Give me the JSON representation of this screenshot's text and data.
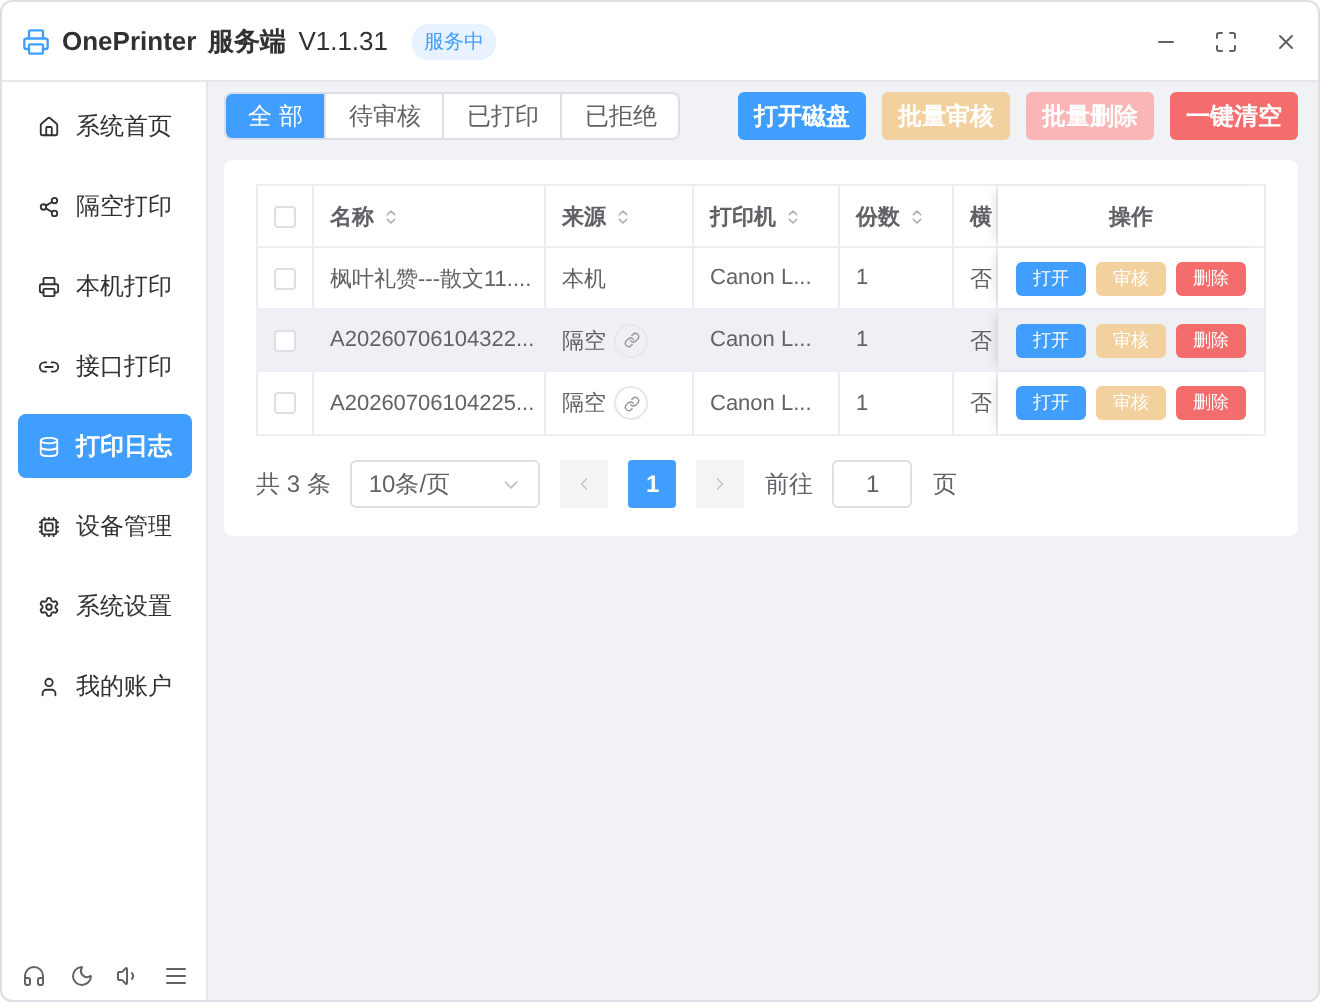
{
  "window": {
    "app": "OnePrinter",
    "subtitle": "服务端",
    "version": "V1.1.31",
    "status": "服务中"
  },
  "sidebar": {
    "items": [
      {
        "label": "系统首页",
        "selected": false
      },
      {
        "label": "隔空打印",
        "selected": false
      },
      {
        "label": "本机打印",
        "selected": false
      },
      {
        "label": "接口打印",
        "selected": false
      },
      {
        "label": "打印日志",
        "selected": true
      },
      {
        "label": "设备管理",
        "selected": false
      },
      {
        "label": "系统设置",
        "selected": false
      },
      {
        "label": "我的账户",
        "selected": false
      }
    ]
  },
  "tabs": [
    {
      "label": "全 部",
      "selected": true
    },
    {
      "label": "待审核",
      "selected": false
    },
    {
      "label": "已打印",
      "selected": false
    },
    {
      "label": "已拒绝",
      "selected": false
    }
  ],
  "actions": [
    {
      "label": "打开磁盘",
      "kind": "primary",
      "disabled": false
    },
    {
      "label": "批量审核",
      "kind": "warning",
      "disabled": true
    },
    {
      "label": "批量删除",
      "kind": "danger",
      "disabled": true
    },
    {
      "label": "一键清空",
      "kind": "danger",
      "disabled": false
    }
  ],
  "table": {
    "select_all_checked": false,
    "columns": [
      {
        "label": "名称",
        "sortable": true
      },
      {
        "label": "来源",
        "sortable": true
      },
      {
        "label": "打印机",
        "sortable": true
      },
      {
        "label": "份数",
        "sortable": true
      },
      {
        "label": "横",
        "sortable": false
      }
    ],
    "action_column": "操作",
    "rows": [
      {
        "checked": false,
        "highlighted": false,
        "name": "枫叶礼赞---散文11....",
        "source": "本机",
        "linked": false,
        "printer": "Canon L...",
        "copies": "1",
        "column_5": "否",
        "buttons": [
          {
            "label": "打开",
            "kind": "primary",
            "disabled": false
          },
          {
            "label": "审核",
            "kind": "warning",
            "disabled": true
          },
          {
            "label": "删除",
            "kind": "danger",
            "disabled": false
          }
        ]
      },
      {
        "checked": false,
        "highlighted": true,
        "name": "A20260706104322...",
        "source": "隔空",
        "linked": true,
        "printer": "Canon L...",
        "copies": "1",
        "column_5": "否",
        "buttons": [
          {
            "label": "打开",
            "kind": "primary",
            "disabled": false
          },
          {
            "label": "审核",
            "kind": "warning",
            "disabled": true
          },
          {
            "label": "删除",
            "kind": "danger",
            "disabled": false
          }
        ]
      },
      {
        "checked": false,
        "highlighted": false,
        "name": "A20260706104225...",
        "source": "隔空",
        "linked": true,
        "printer": "Canon L...",
        "copies": "1",
        "column_5": "否",
        "buttons": [
          {
            "label": "打开",
            "kind": "primary",
            "disabled": false
          },
          {
            "label": "审核",
            "kind": "warning",
            "disabled": true
          },
          {
            "label": "删除",
            "kind": "danger",
            "disabled": false
          }
        ]
      }
    ]
  },
  "pagination": {
    "total": "共 3 条",
    "page_size": "10条/页",
    "pages": [
      {
        "label": "1",
        "selected": true
      }
    ],
    "goto_label": "前往",
    "goto_value": "1",
    "goto_suffix": "页"
  }
}
